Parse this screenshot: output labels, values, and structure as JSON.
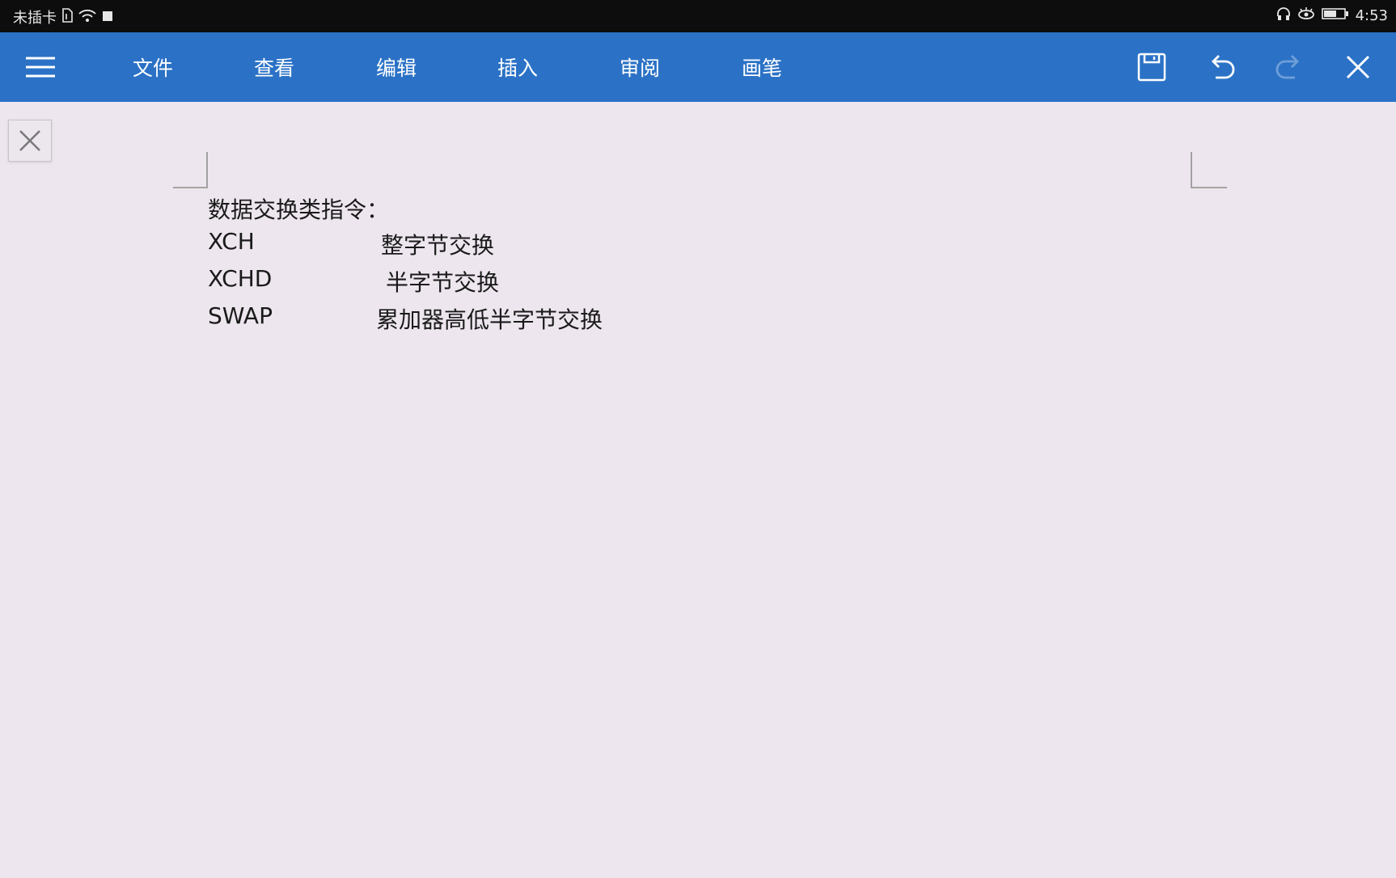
{
  "status_bar": {
    "carrier": "未插卡",
    "time": "4:53",
    "icons": [
      "sim-icon",
      "wifi-icon",
      "notification-square-icon",
      "headphones-icon",
      "eye-care-icon",
      "battery-icon"
    ]
  },
  "toolbar": {
    "tabs": [
      "文件",
      "查看",
      "编辑",
      "插入",
      "审阅",
      "画笔"
    ],
    "icons": [
      "hamburger-menu-icon",
      "save-icon",
      "undo-icon",
      "redo-icon",
      "close-icon"
    ],
    "accent_color": "#2b72c6"
  },
  "document": {
    "heading": "数据交换类指令：",
    "rows": [
      {
        "command": "XCH",
        "description": "整字节交换"
      },
      {
        "command": "XCHD",
        "description": "半字节交换"
      },
      {
        "command": "SWAP",
        "description": "累加器高低半字节交换"
      }
    ]
  }
}
